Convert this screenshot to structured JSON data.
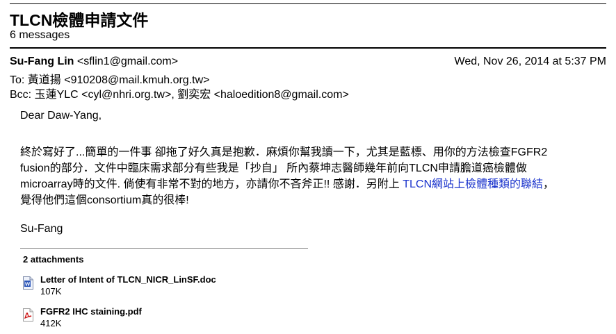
{
  "thread": {
    "subject": "TLCN檢體申請文件",
    "count": "6 messages"
  },
  "message": {
    "from_name": "Su-Fang Lin",
    "from_email": "<sflin1@gmail.com>",
    "date": "Wed, Nov 26, 2014 at 5:37 PM",
    "to_label": "To:",
    "to": "黃道揚 <910208@mail.kmuh.org.tw>",
    "bcc_label": "Bcc:",
    "bcc": "玉蓮YLC <cyl@nhri.org.tw>, 劉奕宏 <haloedition8@gmail.com>"
  },
  "body": {
    "greeting": "Dear Daw-Yang,",
    "line1": "終於寫好了...簡單的一件事 卻拖了好久真是抱歉．麻煩你幫我讀一下，尤其是藍標、用你的方法檢查FGFR2",
    "line2": "fusion的部分．文件中臨床需求部分有些我是「抄自」 所內蔡坤志醫師幾年前向TLCN申請膽道癌檢體做",
    "line3_a": "microarray時的文件. 倘使有非常不對的地方，亦請你不吝斧正!! 感謝．另附上 ",
    "line3_link": "TLCN網站上檢體種類的聯結",
    "line3_b": "，",
    "line4": "覺得他們這個consortium真的很棒!",
    "signature": "Su-Fang"
  },
  "attachments": {
    "title": "2 attachments",
    "items": [
      {
        "name": "Letter of Intent of TLCN_NICR_LinSF.doc",
        "size": "107K",
        "icon": "word-doc-icon"
      },
      {
        "name": "FGFR2 IHC staining.pdf",
        "size": "412K",
        "icon": "pdf-icon"
      }
    ]
  },
  "colors": {
    "link": "#1a33cc",
    "pdf": "#cc1111",
    "doc": "#2a55b8"
  }
}
